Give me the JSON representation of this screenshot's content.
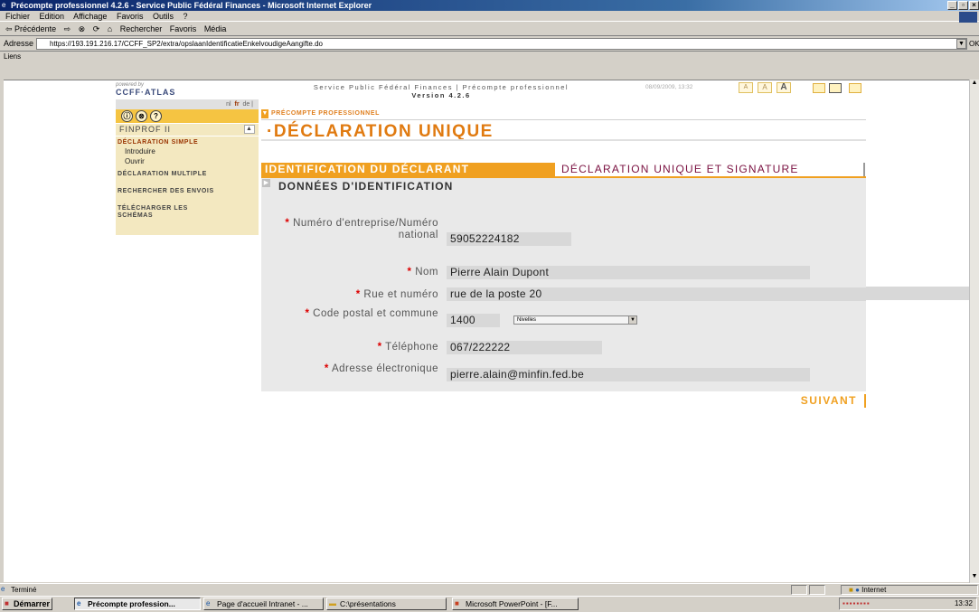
{
  "window": {
    "title": "Précompte professionnel 4.2.6 - Service Public Fédéral Finances - Microsoft Internet Explorer",
    "controls": [
      "_",
      "▫",
      "×"
    ]
  },
  "menu": [
    "Fichier",
    "Edition",
    "Affichage",
    "Favoris",
    "Outils",
    "?"
  ],
  "toolbar": {
    "back": "⇦ Précédente",
    "forward": "⇨",
    "stop": "⊗",
    "refresh": "⟳",
    "home": "⌂",
    "search": "Rechercher",
    "favorites": "Favoris",
    "media": "Média"
  },
  "address": {
    "label": "Adresse",
    "url": "https://193.191.216.17/CCFF_SP2/extra/opslaanIdentificatieEnkelvoudigeAangifte.do",
    "go": "OK"
  },
  "links_label": "Liens",
  "app": {
    "powered_by": "powered by",
    "logo": "CCFF·ATLAS",
    "service_line": "Service Public Fédéral Finances | Précompte professionnel",
    "version": "Version 4.2.6",
    "date": "08/09/2009, 13:32",
    "size_buttons": [
      "A",
      "A",
      "A"
    ],
    "languages": [
      "nl",
      "fr",
      "de"
    ],
    "help_icons": [
      "ⓘ",
      "⊗",
      "?"
    ]
  },
  "sidebar": {
    "app_name": "FINPROF II",
    "sections": [
      {
        "label": "DÉCLARATION SIMPLE",
        "items": [
          "Introduire",
          "Ouvrir"
        ]
      },
      {
        "label": "DÉCLARATION MULTIPLE",
        "items": []
      },
      {
        "label": "RECHERCHER DES ENVOIS",
        "items": []
      },
      {
        "label": "TÉLÉCHARGER LES SCHÉMAS",
        "items": []
      }
    ]
  },
  "main": {
    "breadcrumb": "PRÉCOMPTE PROFESSIONNEL",
    "title": "·DÉCLARATION UNIQUE",
    "tabs": [
      {
        "label": "IDENTIFICATION DU DÉCLARANT",
        "active": true
      },
      {
        "label": "DÉCLARATION UNIQUE ET SIGNATURE",
        "active": false
      }
    ],
    "section_title": "DONNÉES D'IDENTIFICATION",
    "fields": {
      "enterprise": {
        "label": "Numéro d'entreprise/Numéro national",
        "value": "59052224182"
      },
      "name": {
        "label": "Nom",
        "value": "Pierre Alain Dupont"
      },
      "street": {
        "label": "Rue et numéro",
        "value": "rue de la poste 20"
      },
      "postal": {
        "label": "Code postal et commune",
        "value": "1400",
        "commune": "Nivelles"
      },
      "phone": {
        "label": "Téléphone",
        "value": "067/222222"
      },
      "email": {
        "label": "Adresse électronique",
        "value": "pierre.alain@minfin.fed.be"
      }
    },
    "required_mark": "*",
    "next_button": "SUIVANT"
  },
  "status": {
    "text": "Terminé",
    "zone": "Internet"
  },
  "taskbar": {
    "start": "Démarrer",
    "tasks": [
      "Précompte profession...",
      "Page d'accueil Intranet - ...",
      "C:\\présentations",
      "Microsoft PowerPoint - [F..."
    ],
    "clock": "13:32"
  },
  "colors": {
    "accent": "#f0a020",
    "title": "#e07a10",
    "tab_inactive_text": "#7a1040",
    "required": "#dd0000"
  }
}
